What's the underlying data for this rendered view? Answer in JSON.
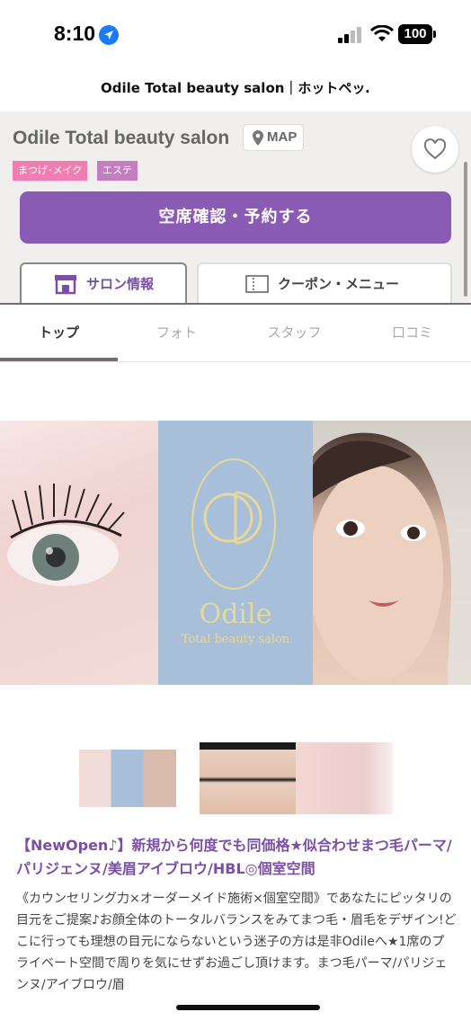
{
  "status_bar": {
    "time": "8:10",
    "battery": "100"
  },
  "page": {
    "title": "Odile Total beauty salon｜ホットペッ…"
  },
  "salon": {
    "name": "Odile Total beauty salon",
    "map_label": "MAP",
    "tags": [
      "まつげ･メイク",
      "エステ"
    ],
    "reserve_label": "空席確認・予約する"
  },
  "tabs": {
    "salon_info": "サロン情報",
    "coupon_menu": "クーポン・メニュー"
  },
  "sub_tabs": [
    "トップ",
    "フォト",
    "スタッフ",
    "口コミ"
  ],
  "hero": {
    "brand": "Odile",
    "subtitle": "Total beauty salon"
  },
  "content": {
    "headline": "【NewOpen♪】新規から何度でも同価格★似合わせまつ毛パーマ/パリジェンヌ/美眉アイブロウ/HBL◎個室空間",
    "description": "《カウンセリング力×オーダーメイド施術×個室空間》であなたにピッタリの目元をご提案♪お顔全体のトータルバランスをみてまつ毛・眉毛をデザイン!どこに行っても理想の目元にならないという迷子の方は是非Odileへ★1席のプライベート空間で周りを気にせずお過ごし頂けます。まつ毛パーマ/パリジェンヌ/アイブロウ/眉"
  },
  "colors": {
    "accent_purple": "#8a5bb4",
    "tag_pink": "#ef7fb2",
    "tag_violet": "#c37ec0",
    "header_bg": "#f0efee"
  }
}
